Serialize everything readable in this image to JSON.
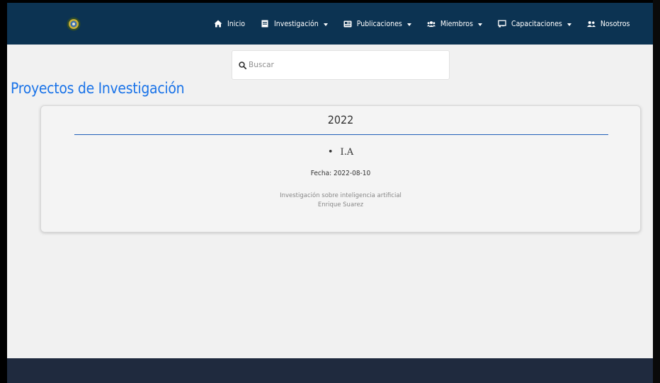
{
  "navbar": {
    "items": [
      {
        "label": "Inicio",
        "icon": "home-icon",
        "dropdown": false
      },
      {
        "label": "Investigación",
        "icon": "book-icon",
        "dropdown": true
      },
      {
        "label": "Publicaciones",
        "icon": "newspaper-icon",
        "dropdown": true
      },
      {
        "label": "Miembros",
        "icon": "users-icon",
        "dropdown": true
      },
      {
        "label": "Capacitaciones",
        "icon": "chalkboard-icon",
        "dropdown": true
      },
      {
        "label": "Nosotros",
        "icon": "user-friends-icon",
        "dropdown": false
      }
    ]
  },
  "search": {
    "placeholder": "Buscar",
    "value": ""
  },
  "page": {
    "title": "Proyectos de Investigación"
  },
  "projects": [
    {
      "year": "2022",
      "name": "I.A",
      "date": "Fecha: 2022-08-10",
      "description": "Investigación sobre inteligencia artificial",
      "author": "Enrique Suarez"
    }
  ],
  "colors": {
    "navbar": "#0c3352",
    "accent": "#1a73e8",
    "divider": "#1f5fb8",
    "footer": "#1f2a3e",
    "background": "#f1f1f1"
  }
}
